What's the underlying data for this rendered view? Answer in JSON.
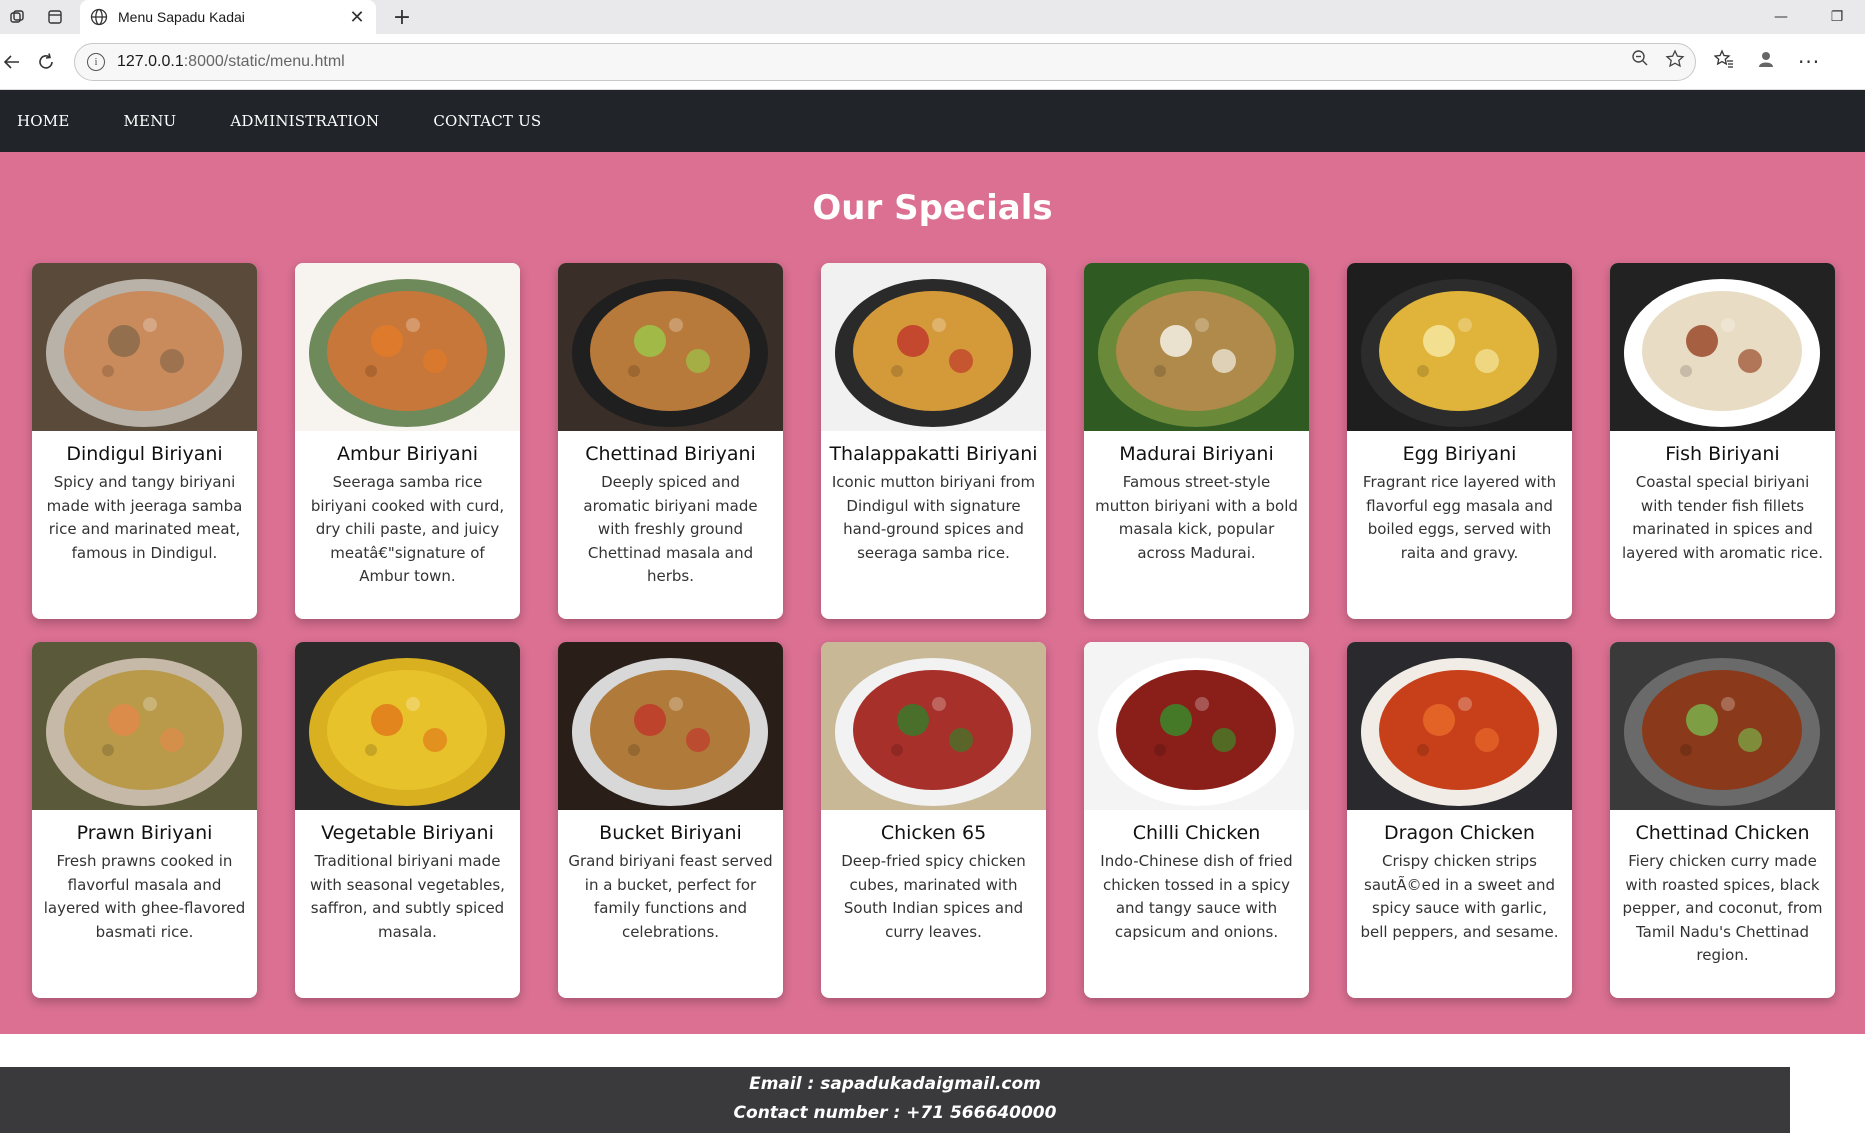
{
  "browser": {
    "tab_title": "Menu Sapadu Kadai",
    "url_host": "127.0.0.1",
    "url_rest": ":8000/static/menu.html"
  },
  "nav": {
    "items": [
      {
        "label": "HOME"
      },
      {
        "label": "MENU"
      },
      {
        "label": "ADMINISTRATION"
      },
      {
        "label": "CONTACT US"
      }
    ]
  },
  "page": {
    "heading": "Our Specials"
  },
  "cards": [
    {
      "name": "Dindigul Biriyani",
      "desc": "Spicy and tangy biriyani made with jeeraga samba rice and marinated meat, famous in Dindigul.",
      "img": {
        "bg": "#5a4a3a",
        "plate": "#b9b2a8",
        "food": "#c98a5c",
        "accent": "#8a6a4a"
      }
    },
    {
      "name": "Ambur Biriyani",
      "desc": "Seeraga samba rice biriyani cooked with curd, dry chili paste, and juicy meatâ€\"signature of Ambur town.",
      "img": {
        "bg": "#f7f3ee",
        "plate": "#6e8a5a",
        "food": "#c8773a",
        "accent": "#e07a2a"
      }
    },
    {
      "name": "Chettinad Biriyani",
      "desc": "Deeply spiced and aromatic biriyani made with freshly ground Chettinad masala and herbs.",
      "img": {
        "bg": "#3a2e28",
        "plate": "#1f1f1f",
        "food": "#b87a3a",
        "accent": "#9cc54a"
      }
    },
    {
      "name": "Thalappakatti Biriyani",
      "desc": "Iconic mutton biriyani from Dindigul with signature hand-ground spices and seeraga samba rice.",
      "img": {
        "bg": "#f1f1f1",
        "plate": "#2a2a2a",
        "food": "#d49a3a",
        "accent": "#c0392b"
      }
    },
    {
      "name": "Madurai Biriyani",
      "desc": "Famous street-style mutton biriyani with a bold masala kick, popular across Madurai.",
      "img": {
        "bg": "#2f5a22",
        "plate": "#6a8a3a",
        "food": "#b08a4a",
        "accent": "#f4f0e6"
      }
    },
    {
      "name": "Egg Biriyani",
      "desc": "Fragrant rice layered with flavorful egg masala and boiled eggs, served with raita and gravy.",
      "img": {
        "bg": "#1e1e1e",
        "plate": "#2c2c2c",
        "food": "#e0b43a",
        "accent": "#f5e6a0"
      }
    },
    {
      "name": "Fish Biriyani",
      "desc": "Coastal special biriyani with tender fish fillets marinated in spices and layered with aromatic rice.",
      "img": {
        "bg": "#222222",
        "plate": "#ffffff",
        "food": "#e8dcc4",
        "accent": "#9a4a2a"
      }
    },
    {
      "name": "Prawn Biriyani",
      "desc": "Fresh prawns cooked in flavorful masala and layered with ghee-flavored basmati rice.",
      "img": {
        "bg": "#5a5a3a",
        "plate": "#c7b9a8",
        "food": "#b89a4a",
        "accent": "#e08a4a"
      }
    },
    {
      "name": "Vegetable Biriyani",
      "desc": "Traditional biriyani made with seasonal vegetables, saffron, and subtly spiced masala.",
      "img": {
        "bg": "#2a2a2a",
        "plate": "#d9b020",
        "food": "#e8c22a",
        "accent": "#e07a1a"
      }
    },
    {
      "name": "Bucket Biriyani",
      "desc": "Grand biriyani feast served in a bucket, perfect for family functions and celebrations.",
      "img": {
        "bg": "#2a1e18",
        "plate": "#d8d8d8",
        "food": "#b07a3a",
        "accent": "#c0392b"
      }
    },
    {
      "name": "Chicken 65",
      "desc": "Deep-fried spicy chicken cubes, marinated with South Indian spices and curry leaves.",
      "img": {
        "bg": "#c8b896",
        "plate": "#f2f2f2",
        "food": "#a8302a",
        "accent": "#3a7a2a"
      }
    },
    {
      "name": "Chilli Chicken",
      "desc": "Indo-Chinese dish of fried chicken tossed in a spicy and tangy sauce with capsicum and onions.",
      "img": {
        "bg": "#f4f4f4",
        "plate": "#ffffff",
        "food": "#8a1f1a",
        "accent": "#3a8a2a"
      }
    },
    {
      "name": "Dragon Chicken",
      "desc": "Crispy chicken strips sautÃ©ed in a sweet and spicy sauce with garlic, bell peppers, and sesame.",
      "img": {
        "bg": "#2a2a2e",
        "plate": "#f1ede6",
        "food": "#c8401a",
        "accent": "#e86a2a"
      }
    },
    {
      "name": "Chettinad Chicken",
      "desc": "Fiery chicken curry made with roasted spices, black pepper, and coconut, from Tamil Nadu's Chettinad region.",
      "img": {
        "bg": "#3a3a3a",
        "plate": "#6a6a6a",
        "food": "#8a3a1a",
        "accent": "#7ab04a"
      }
    }
  ],
  "footer": {
    "email": "Email : sapadukadaigmail.com",
    "contact": "Contact number : +71 566640000"
  }
}
